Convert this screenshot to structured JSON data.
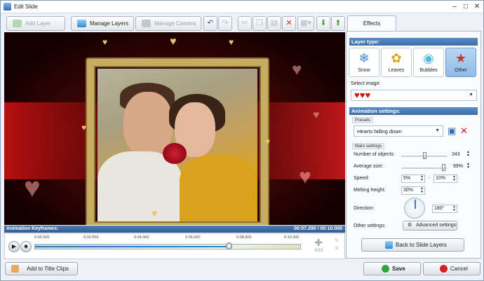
{
  "window": {
    "title": "Edit Slide"
  },
  "toolbar": {
    "add_layer": "Add Layer",
    "manage_layers": "Manage Layers",
    "manage_camera": "Manage Camera"
  },
  "keyframes": {
    "label": "Animation Keyframes:",
    "time": "00:07.290 / 00:10.000",
    "ticks": [
      "0:00.000",
      "0:02.000",
      "0:04.000",
      "0:06.000",
      "0:08.000",
      "0:10.000"
    ],
    "add_label": "Add",
    "progress": 0.729
  },
  "buttons": {
    "add_title_clips": "Add to Title Clips",
    "save": "Save",
    "cancel": "Cancel",
    "back": "Back to Slide Layers"
  },
  "panel": {
    "tab": "Effects",
    "layer_type_head": "Layer type:",
    "types": [
      "Snow",
      "Leaves",
      "Bubbles",
      "Other"
    ],
    "select_image": "Select image:",
    "anim_head": "Animation settings:",
    "presets_label": "Presets",
    "preset_value": "Hearts falling down",
    "main_settings": "Main settings",
    "num_objects_label": "Number of objects:",
    "num_objects": "343",
    "avg_size_label": "Average size:",
    "avg_size": "99%",
    "speed_label": "Speed:",
    "speed_min": "5%",
    "speed_sep": "-",
    "speed_max": "10%",
    "melting_label": "Melting height:",
    "melting": "30%",
    "direction_label": "Direction:",
    "direction": "180°",
    "other_label": "Other settings:",
    "advanced": "Advanced settings"
  },
  "colors": {
    "accent": "#3b6ca8",
    "save": "#2fa43a",
    "cancel": "#d02424"
  }
}
